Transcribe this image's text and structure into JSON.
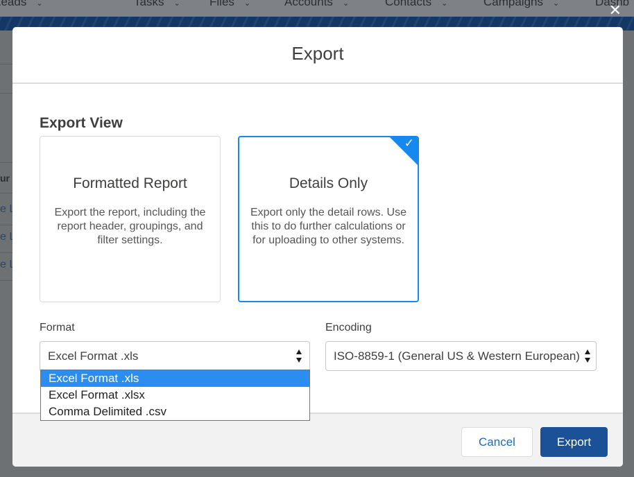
{
  "background_app": {
    "nav_items": [
      "Leads",
      "Tasks",
      "Files",
      "Accounts",
      "Contacts",
      "Campaigns",
      "Dashb"
    ],
    "table_header_fragment": "ur",
    "link_fragments": [
      "e Le",
      "e Le",
      "e Le"
    ]
  },
  "overlay_close_glyph": "✕",
  "modal": {
    "title": "Export",
    "section_title": "Export View",
    "views": [
      {
        "title": "Formatted Report",
        "description": "Export the report, including the report header, groupings, and filter settings.",
        "selected": false
      },
      {
        "title": "Details Only",
        "description": "Export only the detail rows. Use this to do further calculations or for uploading to other systems.",
        "selected": true
      }
    ],
    "selected_check_glyph": "✓",
    "format": {
      "label": "Format",
      "value": "Excel Format .xls",
      "open": true,
      "options": [
        "Excel Format .xls",
        "Excel Format .xlsx",
        "Comma Delimited .csv"
      ],
      "highlighted_option": "Excel Format .xls"
    },
    "encoding": {
      "label": "Encoding",
      "value": "ISO-8859-1 (General US & Western European)"
    },
    "buttons": {
      "cancel": "Cancel",
      "export": "Export"
    }
  },
  "colors": {
    "brand_blue": "#1b5297",
    "selection_blue": "#1589ee",
    "dropdown_highlight": "#2b8df0",
    "link_blue": "#1b6ac0"
  },
  "icons": {
    "close": "close-icon",
    "check": "check-icon",
    "select_arrows": "up-down-arrows-icon",
    "nav_caret": "chevron-down-icon"
  }
}
